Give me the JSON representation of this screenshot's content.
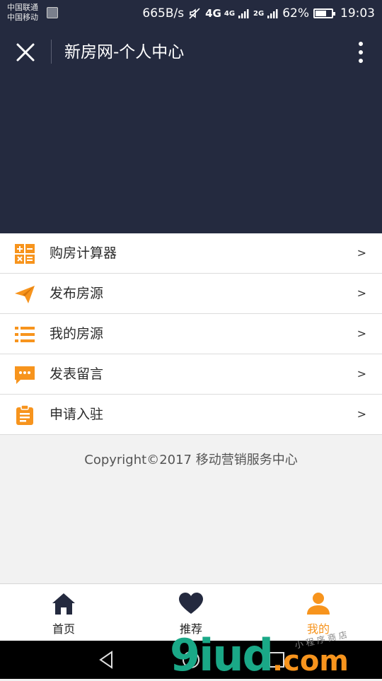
{
  "status_bar": {
    "carrier_1": "中国联通",
    "carrier_2": "中国移动",
    "net_speed": "665B/s",
    "network_1": "4G",
    "network_2": "4G",
    "network_3": "2G",
    "battery": "62%",
    "battery_level": 0.62,
    "time": "19:03"
  },
  "app_bar": {
    "title": "新房网-个人中心"
  },
  "menu": {
    "items": [
      {
        "label": "购房计算器",
        "arrow": ">",
        "icon": "calculator-icon"
      },
      {
        "label": "发布房源",
        "arrow": ">",
        "icon": "paper-plane-icon"
      },
      {
        "label": "我的房源",
        "arrow": ">",
        "icon": "list-icon"
      },
      {
        "label": "发表留言",
        "arrow": ">",
        "icon": "chat-bubble-icon"
      },
      {
        "label": "申请入驻",
        "arrow": ">",
        "icon": "clipboard-icon"
      }
    ]
  },
  "footer": {
    "copyright": "Copyright©2017 移动营销服务中心"
  },
  "tabbar": {
    "tabs": [
      {
        "label": "首页",
        "icon": "home-icon",
        "active": false
      },
      {
        "label": "推荐",
        "icon": "heart-icon",
        "active": false
      },
      {
        "label": "我的",
        "icon": "user-icon",
        "active": true
      }
    ]
  },
  "watermark": {
    "brand": "9iud",
    "domain": ".com",
    "tagline": "小 程 序 商 店"
  },
  "colors": {
    "header_bg": "#242a3f",
    "accent": "#f7941d",
    "page_bg": "#f2f2f2"
  }
}
